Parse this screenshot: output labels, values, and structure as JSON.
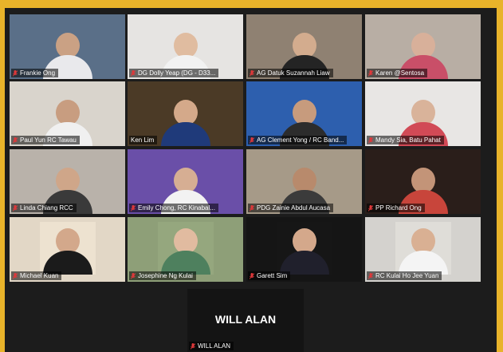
{
  "meeting": {
    "participants": [
      {
        "name": "Frankie Ong",
        "bg": "#5a6f88",
        "shirt": "#e9e9ec",
        "skin": "#caa184",
        "muted": true,
        "active": false
      },
      {
        "name": "DG Dolly Yeap (DG - D33...",
        "bg": "#e6e4e2",
        "shirt": "#f2f2f2",
        "skin": "#e0bca0",
        "muted": true,
        "active": false
      },
      {
        "name": "AG Datuk Suzannah Liaw",
        "bg": "#8f8172",
        "shirt": "#242424",
        "skin": "#d3ac8e",
        "muted": true,
        "active": false
      },
      {
        "name": "Karen @Sentosa",
        "bg": "#b8aea4",
        "shirt": "#c94f68",
        "skin": "#d8b09a",
        "muted": true,
        "active": false
      },
      {
        "name": "Paul Yun RC Tawau",
        "bg": "#d9d4cc",
        "shirt": "#f0f0f0",
        "skin": "#c89d80",
        "muted": true,
        "active": false
      },
      {
        "name": "Ken Lim",
        "bg": "#4b3a26",
        "shirt": "#1f3a7a",
        "skin": "#d4a98a",
        "muted": false,
        "active": true
      },
      {
        "name": "AG Clement Yong / RC Band...",
        "bg": "#2d5fae",
        "shirt": "#2c2c2c",
        "skin": "#c79b7d",
        "muted": true,
        "active": false
      },
      {
        "name": "Mandy Sia, Batu Pahat",
        "bg": "#e8e6e4",
        "shirt": "#d14a56",
        "skin": "#d9b39a",
        "muted": true,
        "active": false
      },
      {
        "name": "Linda Chiang RCC",
        "bg": "#b9b2aa",
        "shirt": "#3a3a3a",
        "skin": "#cfa689",
        "muted": true,
        "active": false
      },
      {
        "name": "Emily Chong, RC Kinabal...",
        "bg": "#6a4fa8",
        "shirt": "#f2f2f2",
        "skin": "#d6ae93",
        "muted": true,
        "active": false
      },
      {
        "name": "PDG Zainie Abdul Aucasa",
        "bg": "#a69a88",
        "shirt": "#3b3b3b",
        "skin": "#b88a6c",
        "muted": true,
        "active": false
      },
      {
        "name": "PP Richard Ong",
        "bg": "#2a1e1a",
        "shirt": "#c8453b",
        "skin": "#c39478",
        "muted": true,
        "active": false
      },
      {
        "name": "Michael Kuan",
        "bg": "#e2d7c6",
        "shirt": "#1a1a1a",
        "skin": "#c9a084",
        "muted": true,
        "active": false
      },
      {
        "name": "Josephine Ng Kulai",
        "bg": "#8e9f78",
        "shirt": "#4a7a5a",
        "skin": "#d6b298",
        "muted": true,
        "active": false
      },
      {
        "name": "Garett Sim",
        "bg": "#151515",
        "shirt": "#1e1e2a",
        "skin": "#caa084",
        "muted": true,
        "active": false
      },
      {
        "name": "RC Kulai Ho Jee Yuan",
        "bg": "#d4d2ce",
        "shirt": "#e8e8e8",
        "skin": "#cfa88c",
        "muted": true,
        "active": false
      }
    ],
    "will": {
      "display_name": "WILL ALAN",
      "label": "WILL ALAN"
    }
  },
  "colors": {
    "frame": "#e8b32a",
    "grid_bg": "#1c1c1c",
    "active_border": "#e8d84a",
    "muted_mic": "#e0383a"
  },
  "icons": {
    "muted": "mic-off-icon"
  }
}
